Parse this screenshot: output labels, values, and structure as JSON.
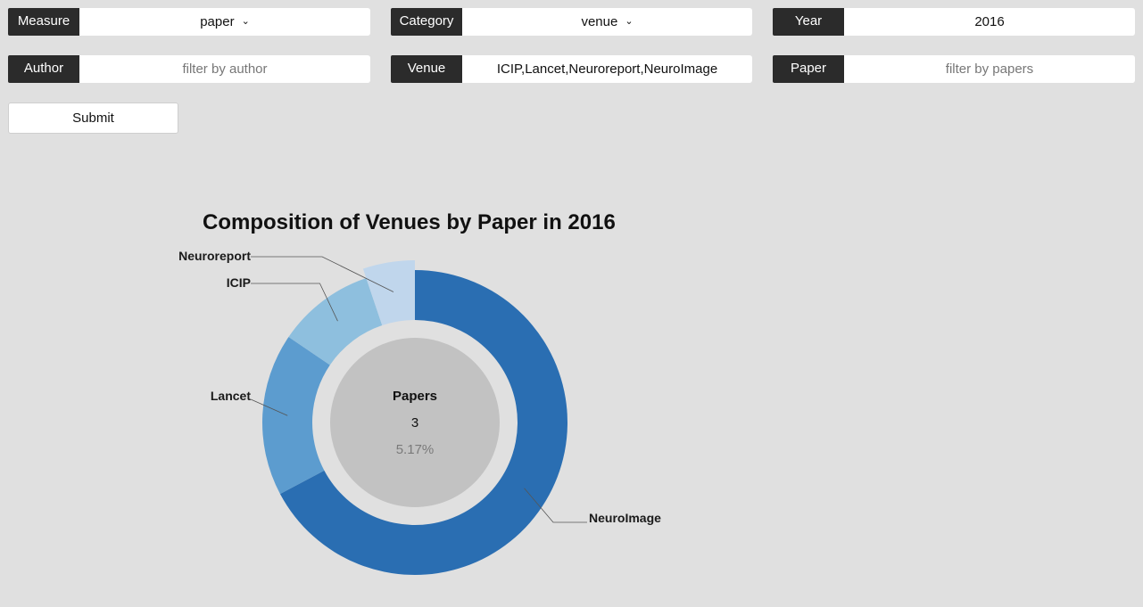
{
  "filters": {
    "measure": {
      "label": "Measure",
      "value": "paper"
    },
    "category": {
      "label": "Category",
      "value": "venue"
    },
    "year": {
      "label": "Year",
      "value": "2016"
    },
    "author": {
      "label": "Author",
      "placeholder": "filter by author"
    },
    "venue": {
      "label": "Venue",
      "value": "ICIP,Lancet,Neuroreport,NeuroImage"
    },
    "paper": {
      "label": "Paper",
      "placeholder": "filter by papers"
    }
  },
  "submit_label": "Submit",
  "chart_data": {
    "type": "pie",
    "variant": "donut",
    "title": "Composition of Venues by Paper in 2016",
    "categories": [
      "NeuroImage",
      "Lancet",
      "ICIP",
      "Neuroreport"
    ],
    "values": [
      39,
      10,
      6,
      3
    ],
    "colors": [
      "#2a6eb2",
      "#5c9ccf",
      "#8ebfde",
      "#c0d6ec"
    ],
    "highlighted": "Neuroreport",
    "center": {
      "title": "Papers",
      "value": "3",
      "percent": "5.17%"
    }
  }
}
